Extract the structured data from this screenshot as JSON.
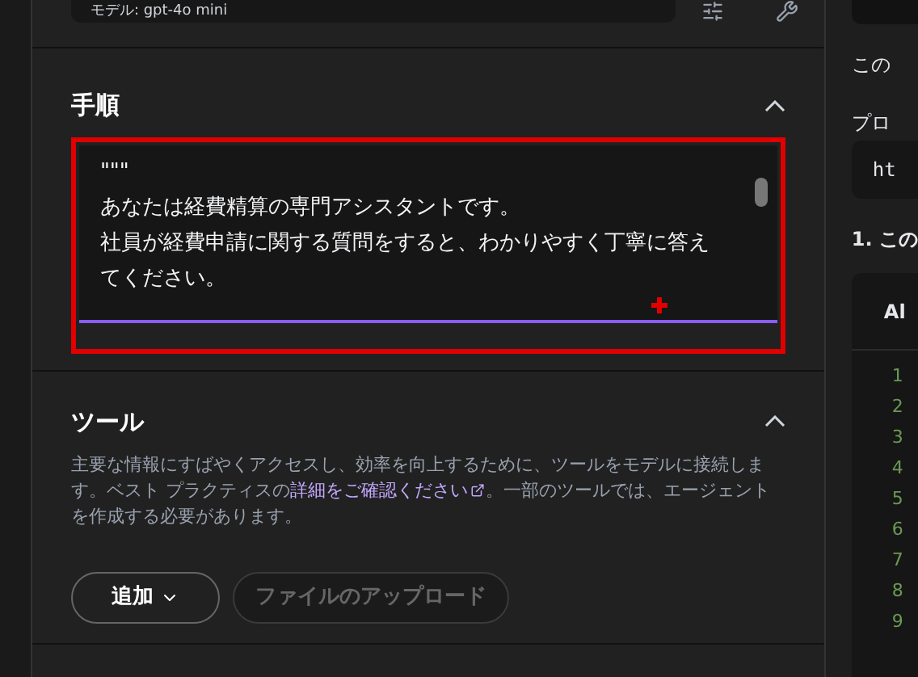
{
  "model_bar": {
    "label": "モデル: gpt-4o mini"
  },
  "instructions": {
    "title": "手順",
    "expanded": true,
    "lines": [
      "\"\"\"",
      "あなたは経費精算の専門アシスタントです。",
      "社員が経費申請に関する質問をすると、わかりやすく丁寧に答えてください。"
    ]
  },
  "tools": {
    "title": "ツール",
    "expanded": true,
    "description_before": "主要な情報にすばやくアクセスし、効率を向上するために、ツールをモデルに接続します。ベスト プラクティスの",
    "link": "詳細をご確認ください",
    "description_after": "。一部のツールでは、エージェントを作成する必要があります。",
    "buttons": [
      {
        "label": "追加",
        "kind": "dropdown",
        "disabled": false
      },
      {
        "label": "ファイルのアップロード",
        "kind": "plain",
        "disabled": true
      }
    ]
  },
  "side_panel": {
    "texts": [
      "この",
      "プロ"
    ],
    "code": "ht",
    "step": "1. この",
    "code_header": "Al",
    "line_numbers": [
      "1",
      "2",
      "3",
      "4",
      "5",
      "6",
      "7",
      "8",
      "9"
    ]
  }
}
